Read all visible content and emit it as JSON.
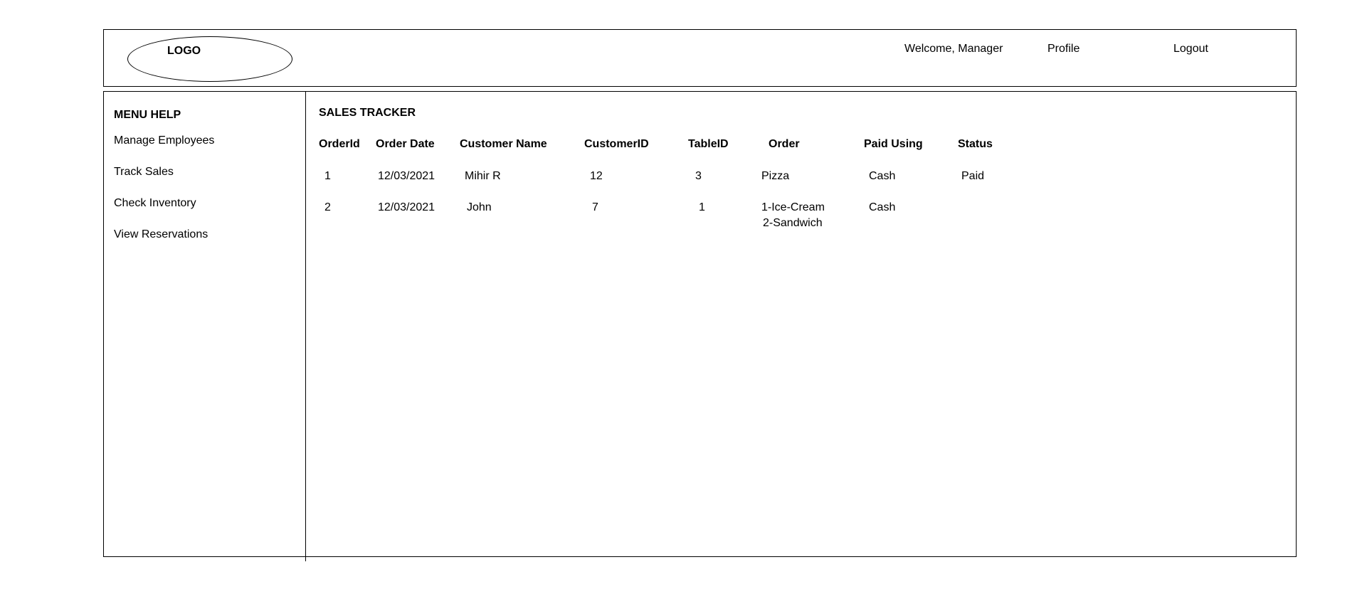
{
  "header": {
    "logo": "LOGO",
    "welcome": "Welcome, Manager",
    "profile": "Profile",
    "logout": "Logout"
  },
  "sidebar": {
    "title": "MENU HELP",
    "items": [
      {
        "label": "Manage Employees"
      },
      {
        "label": "Track Sales"
      },
      {
        "label": "Check Inventory"
      },
      {
        "label": "View Reservations"
      }
    ]
  },
  "main": {
    "title": "SALES TRACKER",
    "columns": [
      "OrderId",
      "Order Date",
      "Customer Name",
      "CustomerID",
      "TableID",
      "Order",
      "Paid Using",
      "Status"
    ],
    "rows": [
      {
        "order_id": "1",
        "order_date": "12/03/2021",
        "customer_name": "Mihir R",
        "customer_id": "12",
        "table_id": "3",
        "order": [
          "Pizza"
        ],
        "paid_using": "Cash",
        "status": "Paid"
      },
      {
        "order_id": "2",
        "order_date": "12/03/2021",
        "customer_name": "John",
        "customer_id": "7",
        "table_id": "1",
        "order": [
          "1-Ice-Cream",
          "2-Sandwich"
        ],
        "paid_using": "Cash",
        "status": ""
      }
    ]
  }
}
